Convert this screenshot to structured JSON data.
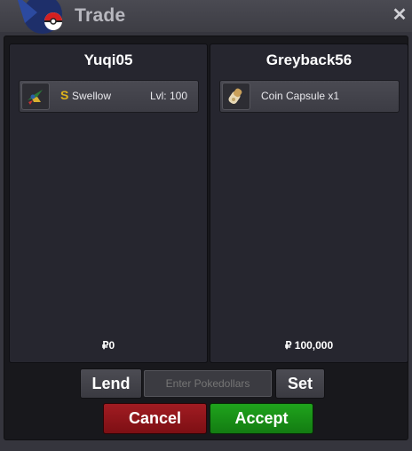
{
  "window": {
    "title": "Trade",
    "close_glyph": "✕"
  },
  "left_panel": {
    "player": "Yuqi05",
    "item": {
      "shiny_mark": "S",
      "name": "Swellow",
      "level": "Lvl: 100",
      "icon": "swellow-sprite-icon"
    },
    "money": "₽0"
  },
  "right_panel": {
    "player": "Greyback56",
    "item": {
      "name": "Coin Capsule  x1",
      "icon": "coin-capsule-icon"
    },
    "money": "₽ 100,000"
  },
  "controls": {
    "lend_label": "Lend",
    "pokedollar_placeholder": "Enter Pokedollars",
    "set_label": "Set",
    "cancel_label": "Cancel",
    "accept_label": "Accept"
  },
  "colors": {
    "cancel": "#a11c22",
    "accept": "#1fa31c",
    "shiny": "#e0b41a"
  }
}
